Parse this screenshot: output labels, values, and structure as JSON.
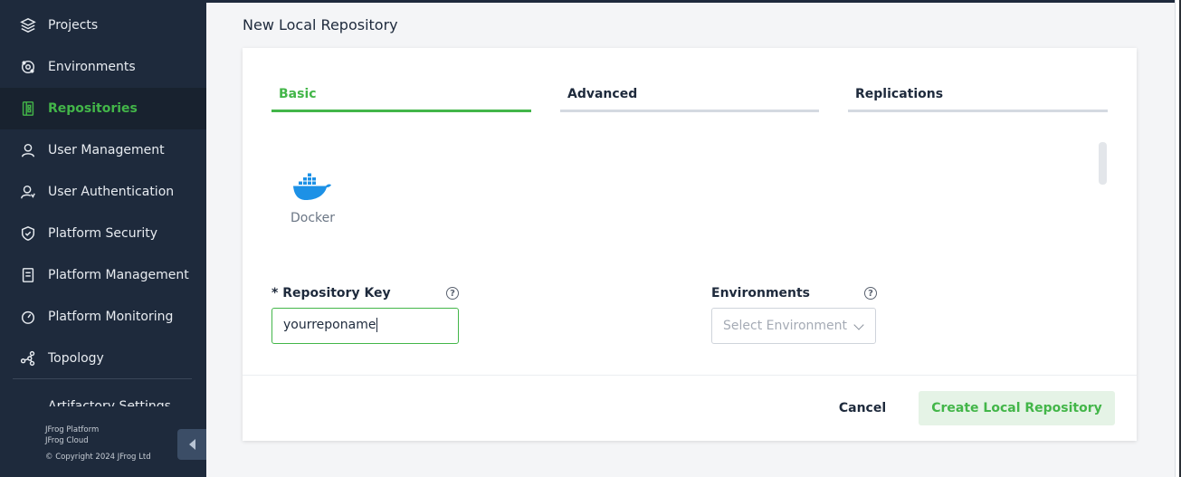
{
  "sidebar": {
    "items": [
      {
        "label": "Projects",
        "icon": "layers-icon"
      },
      {
        "label": "Environments",
        "icon": "environments-icon"
      },
      {
        "label": "Repositories",
        "icon": "repositories-icon",
        "active": true
      },
      {
        "label": "User Management",
        "icon": "user-icon"
      },
      {
        "label": "User Authentication",
        "icon": "user-auth-icon"
      },
      {
        "label": "Platform Security",
        "icon": "shield-icon"
      },
      {
        "label": "Platform Management",
        "icon": "document-icon"
      },
      {
        "label": "Platform Monitoring",
        "icon": "gauge-icon"
      },
      {
        "label": "Topology",
        "icon": "topology-icon"
      }
    ],
    "cut_item_label": "Artifactory Settings",
    "footer": {
      "line1": "JFrog Platform",
      "line2": "JFrog Cloud",
      "copyright": "© Copyright 2024 JFrog Ltd"
    }
  },
  "page": {
    "title": "New Local Repository"
  },
  "tabs": [
    {
      "label": "Basic",
      "active": true
    },
    {
      "label": "Advanced",
      "active": false
    },
    {
      "label": "Replications",
      "active": false
    }
  ],
  "package_type": {
    "label": "Docker",
    "icon": "docker-icon"
  },
  "form": {
    "repository_key": {
      "label": "* Repository Key",
      "value": "yourreponame",
      "help": "?"
    },
    "environments": {
      "label": "Environments",
      "placeholder": "Select Environment",
      "help": "?"
    }
  },
  "actions": {
    "cancel": "Cancel",
    "create": "Create Local Repository"
  },
  "colors": {
    "accent": "#43b649",
    "sidebar_bg": "#1e2a3c"
  }
}
